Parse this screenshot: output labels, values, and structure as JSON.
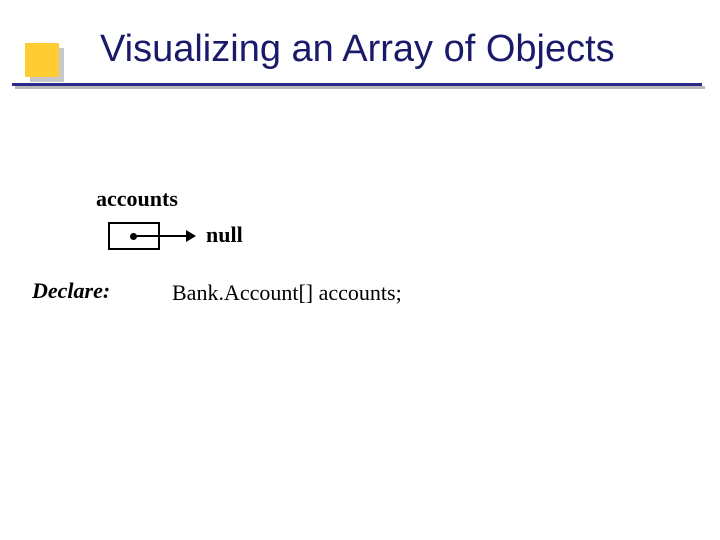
{
  "title": "Visualizing an Array of Objects",
  "diagram": {
    "variable_label": "accounts",
    "pointer_value": "null"
  },
  "steps": {
    "declare": {
      "label": "Declare:",
      "code": "Bank.Account[] accounts;"
    }
  }
}
